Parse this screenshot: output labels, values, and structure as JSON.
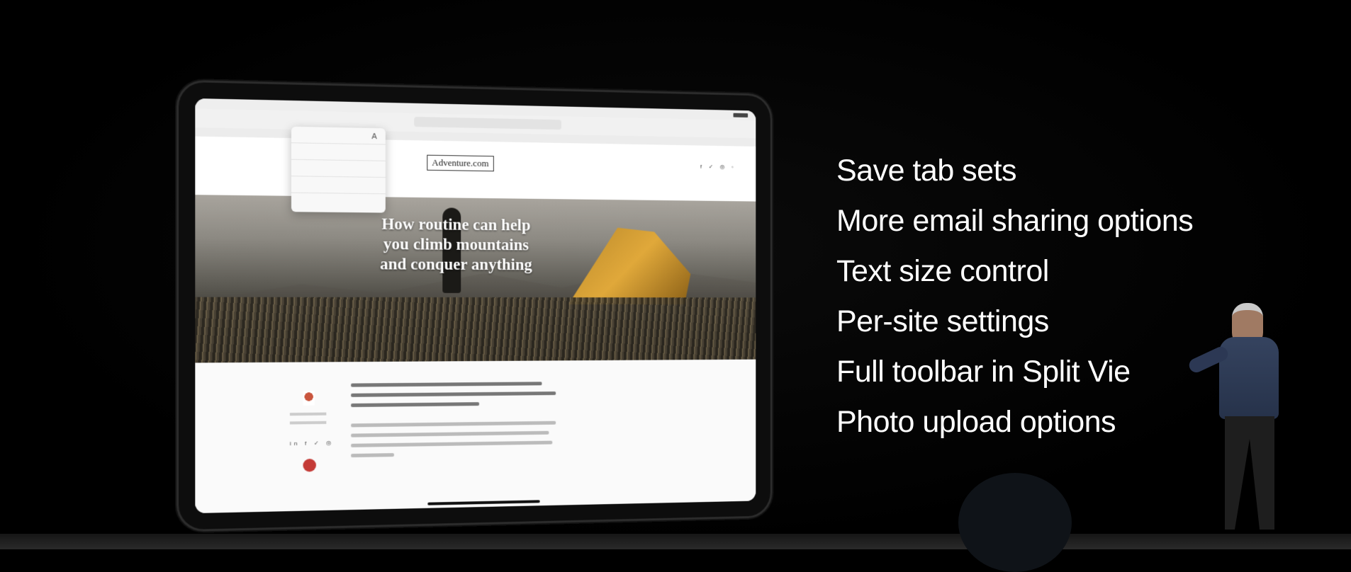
{
  "slide": {
    "features": [
      "Save tab sets",
      "More email sharing options",
      "Text size control",
      "Per-site settings",
      "Full toolbar in Split Vie",
      "Photo upload options"
    ]
  },
  "ipad": {
    "site_logo": "Adventure.com",
    "hero_title_lines": [
      "How routine can help",
      "you climb mountains",
      "and conquer anything"
    ],
    "social_icons": "f ✓ ◎ ◦",
    "share_row": "in f ✓ ◎",
    "text_size_icon": "A"
  },
  "colors": {
    "background": "#000000",
    "slide_text": "#ffffff",
    "tent": "#e0a83a",
    "badge": "#c43a36"
  }
}
